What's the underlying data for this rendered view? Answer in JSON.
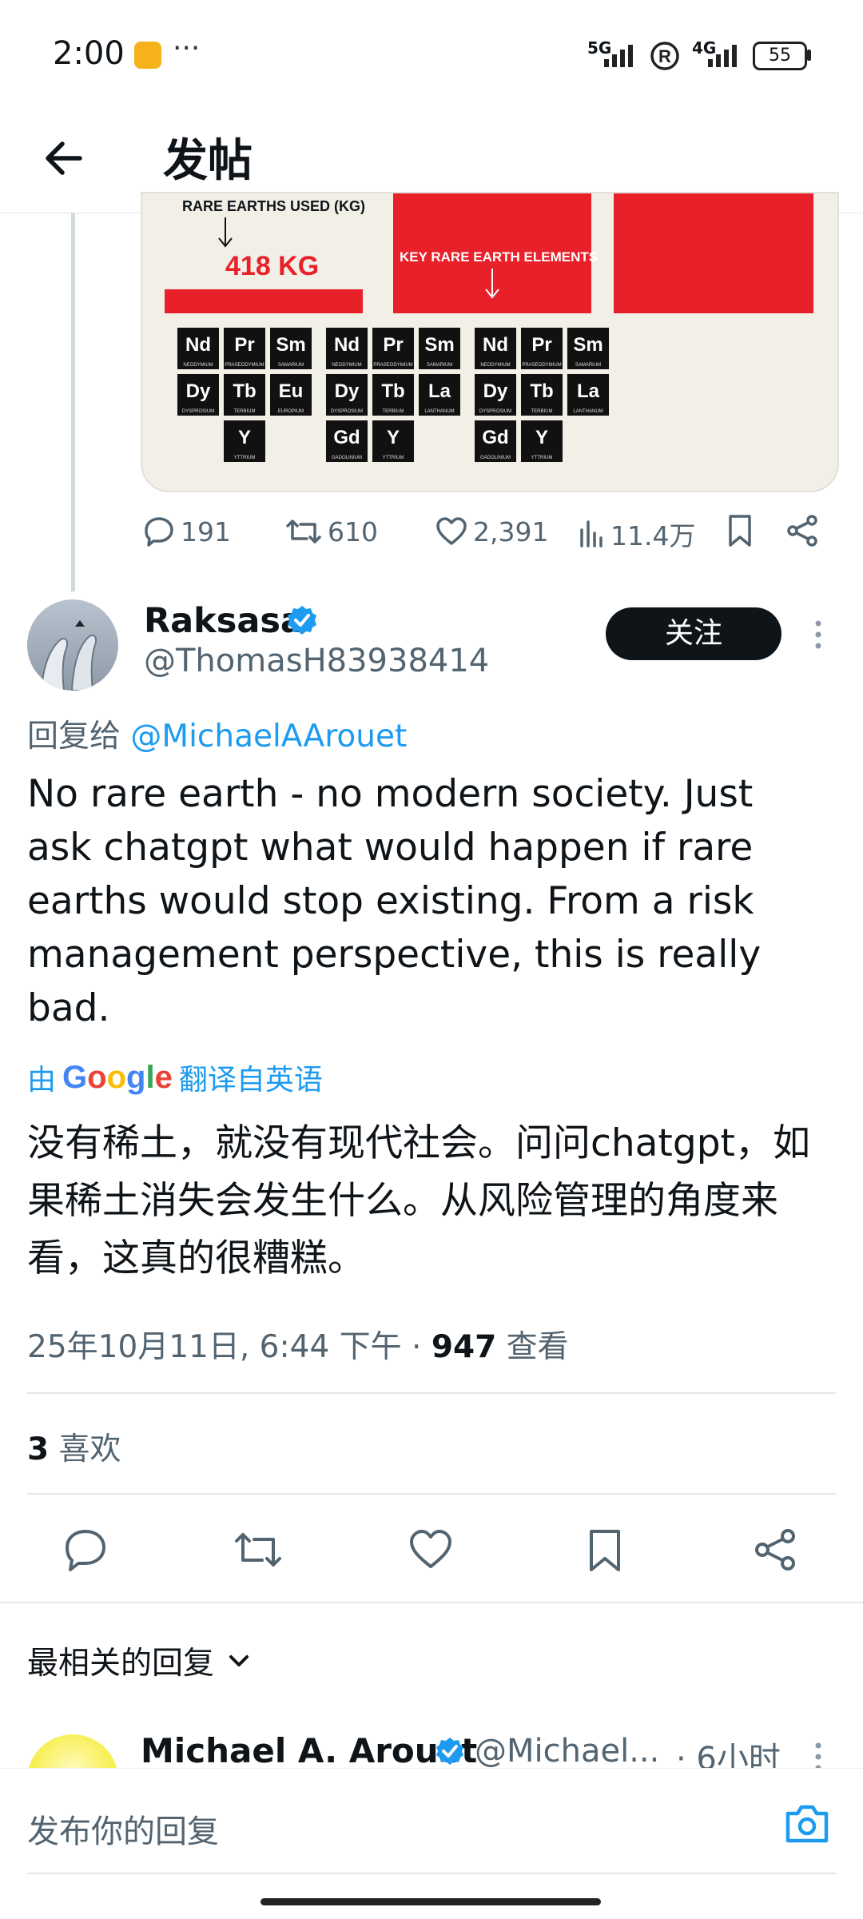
{
  "status_bar": {
    "time": "2:00",
    "more": "···",
    "net1": "5G",
    "net2": "4G",
    "battery": "55"
  },
  "header": {
    "title": "发帖"
  },
  "image": {
    "label_used": "RARE EARTHS USED (KG)",
    "amount": "418 KG",
    "label_key": "KEY RARE EARTH ELEMENTS",
    "groups": [
      [
        {
          "sym": "Nd",
          "name": "NEODYMIUM"
        },
        {
          "sym": "Pr",
          "name": "PRASEODYMIUM"
        },
        {
          "sym": "Sm",
          "name": "SAMARIUM"
        },
        {
          "sym": "Dy",
          "name": "DYSPROSIUM"
        },
        {
          "sym": "Tb",
          "name": "TERBIUM"
        },
        {
          "sym": "Eu",
          "name": "EUROPIUM"
        },
        {
          "sym": "Y",
          "name": "YTTRIUM"
        }
      ],
      [
        {
          "sym": "Nd",
          "name": "NEODYMIUM"
        },
        {
          "sym": "Pr",
          "name": "PRASEODYMIUM"
        },
        {
          "sym": "Sm",
          "name": "SAMARIUM"
        },
        {
          "sym": "Dy",
          "name": "DYSPROSIUM"
        },
        {
          "sym": "Tb",
          "name": "TERBIUM"
        },
        {
          "sym": "La",
          "name": "LANTHANUM"
        },
        {
          "sym": "Gd",
          "name": "GADOLINIUM"
        },
        {
          "sym": "Y",
          "name": "YTTRIUM"
        }
      ],
      [
        {
          "sym": "Nd",
          "name": "NEODYMIUM"
        },
        {
          "sym": "Pr",
          "name": "PRASEODYMIUM"
        },
        {
          "sym": "Sm",
          "name": "SAMARIUM"
        },
        {
          "sym": "Dy",
          "name": "DYSPROSIUM"
        },
        {
          "sym": "Tb",
          "name": "TERBIUM"
        },
        {
          "sym": "La",
          "name": "LANTHANUM"
        },
        {
          "sym": "Gd",
          "name": "GADOLINIUM"
        },
        {
          "sym": "Y",
          "name": "YTTRIUM"
        }
      ]
    ]
  },
  "parent_stats": {
    "replies": "191",
    "retweets": "610",
    "likes": "2,391",
    "views": "11.4万"
  },
  "reply": {
    "name": "Raksasa",
    "handle": "@ThomasH83938414",
    "follow_label": "关注",
    "reply_to_prefix": "回复给",
    "reply_to_handle": "@MichaelAArouet",
    "text": "No rare earth -  no modern society. Just ask chatgpt what would happen if rare earths would stop existing. From a risk management perspective, this is really bad.",
    "translate_prefix": "由",
    "translate_brand": "Google",
    "translate_suffix": "翻译自英语",
    "translated": "没有稀土，就没有现代社会。问问chatgpt，如果稀土消失会发生什么。从风险管理的角度来看，这真的很糟糕。",
    "timestamp": "25年10月11日, 6:44 下午 · ",
    "views_count": "947",
    "views_label": " 查看",
    "likes_count": "3",
    "likes_label": " 喜欢"
  },
  "replies_section": {
    "sort_label": "最相关的回复"
  },
  "next_reply": {
    "name": "Michael A. Arouet",
    "handle": "@Michael...",
    "time": "· 6小时"
  },
  "composer": {
    "placeholder": "发布你的回复"
  },
  "colors": {
    "accent": "#1d9bf0",
    "red": "#e8202a"
  }
}
